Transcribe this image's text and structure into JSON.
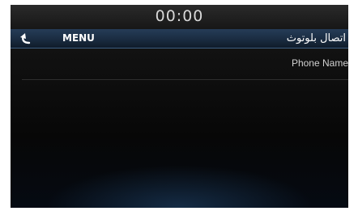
{
  "status_bar": {
    "clock": "00:00"
  },
  "header": {
    "back_icon": "back-arrow-icon",
    "menu_label": "MENU",
    "title": "اتصال بلوتوث"
  },
  "list": {
    "items": [
      {
        "label": "Phone Name"
      }
    ]
  },
  "colors": {
    "header_blue": "#253c57",
    "background": "#000000",
    "text": "#ffffff"
  }
}
